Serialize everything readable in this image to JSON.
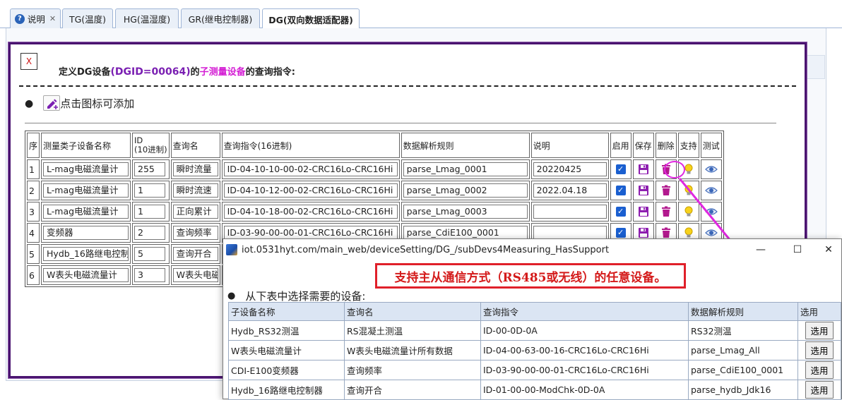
{
  "tabs": [
    {
      "label": "说明",
      "closable": true,
      "active": false
    },
    {
      "label": "TG(温度)",
      "active": false
    },
    {
      "label": "HG(温湿度)",
      "active": false
    },
    {
      "label": "GR(继电控制器)",
      "active": false
    },
    {
      "label": "DG(双向数据适配器)",
      "active": true
    }
  ],
  "dialog": {
    "close_glyph": "X",
    "title_prefix": "定义DG设备",
    "title_dgid": "(DGID=00064)",
    "title_mid": "的",
    "title_highlight": "子测量设备",
    "title_suffix": "的查询指令:",
    "add_label": "点击图标可添加"
  },
  "table": {
    "headers": [
      "序",
      "测量类子设备名称",
      "ID\n(10进制)",
      "查询名",
      "查询指令(16进制)",
      "数据解析规则",
      "说明",
      "启用",
      "保存",
      "删除",
      "支持",
      "测试"
    ],
    "rows": [
      {
        "n": "1",
        "name": "L-mag电磁流量计",
        "id": "255",
        "qname": "瞬时流量",
        "cmd": "ID-04-10-10-00-02-CRC16Lo-CRC16Hi",
        "rule": "parse_Lmag_0001",
        "note": "20220425"
      },
      {
        "n": "2",
        "name": "L-mag电磁流量计",
        "id": "1",
        "qname": "瞬时流速",
        "cmd": "ID-04-10-12-00-02-CRC16Lo-CRC16Hi",
        "rule": "parse_Lmag_0002",
        "note": "2022.04.18"
      },
      {
        "n": "3",
        "name": "L-mag电磁流量计",
        "id": "1",
        "qname": "正向累计",
        "cmd": "ID-04-10-18-00-02-CRC16Lo-CRC16Hi",
        "rule": "parse_Lmag_0003",
        "note": ""
      },
      {
        "n": "4",
        "name": "变频器",
        "id": "2",
        "qname": "查询频率",
        "cmd": "ID-03-90-00-00-01-CRC16Lo-CRC16Hi",
        "rule": "parse_CdiE100_0001",
        "note": ""
      },
      {
        "n": "5",
        "name": "Hydb_16路继电控制",
        "id": "5",
        "qname": "查询开合",
        "cmd": "",
        "rule": "",
        "note": ""
      },
      {
        "n": "6",
        "name": "W表头电磁流量计",
        "id": "3",
        "qname": "W表头电磁",
        "cmd": "",
        "rule": "",
        "note": ""
      }
    ],
    "check_glyph": "✓"
  },
  "popup": {
    "url": "iot.0531hyt.com/main_web/deviceSetting/DG_/subDevs4Measuring_HasSupport",
    "minimize": "—",
    "maximize": "☐",
    "close": "✕",
    "banner": "支持主从通信方式（RS485或无线）的任意设备。",
    "select_prompt": "从下表中选择需要的设备:",
    "headers": [
      "子设备名称",
      "查询名",
      "查询指令",
      "数据解析规则",
      "选用"
    ],
    "rows": [
      {
        "name": "Hydb_RS32测温",
        "qname": "RS混凝土测温",
        "cmd": "ID-00-0D-0A",
        "rule": "RS32测温",
        "btn": "选用"
      },
      {
        "name": "W表头电磁流量计",
        "qname": "W表头电磁流量计所有数据",
        "cmd": "ID-04-00-63-00-16-CRC16Lo-CRC16Hi",
        "rule": "parse_Lmag_All",
        "btn": "选用"
      },
      {
        "name": "CDI-E100变频器",
        "qname": "查询频率",
        "cmd": "ID-03-90-00-00-01-CRC16Lo-CRC16Hi",
        "rule": "parse_CdiE100_0001",
        "btn": "选用"
      },
      {
        "name": "Hydb_16路继电控制器",
        "qname": "查询开合",
        "cmd": "ID-01-00-00-ModChk-0D-0A",
        "rule": "parse_hydb_Jdk16",
        "btn": "选用"
      }
    ]
  },
  "colors": {
    "dialog_border": "#4a1470",
    "dgid": "#7a1fb2",
    "highlight": "#d41ed4",
    "arrow": "#e028e0",
    "banner_red": "#d41b1b",
    "checkbox": "#1a5fd0"
  }
}
